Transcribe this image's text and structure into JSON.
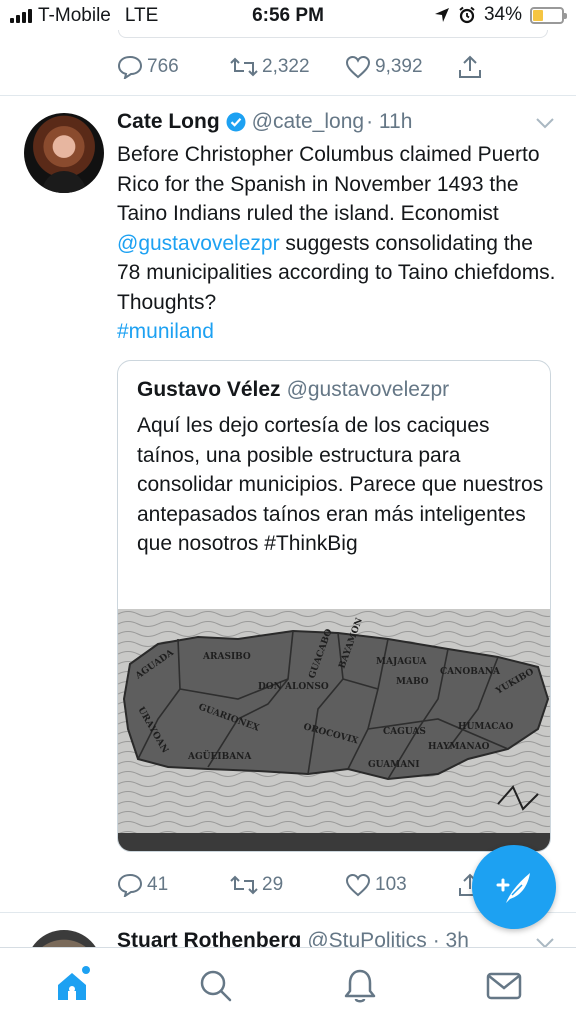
{
  "status_bar": {
    "carrier": "T-Mobile",
    "network": "LTE",
    "time": "6:56 PM",
    "battery": "34%",
    "battery_level": 0.34,
    "icons": [
      "signal-icon",
      "location-arrow-icon",
      "alarm-clock-icon",
      "battery-icon"
    ]
  },
  "previous_tweet": {
    "replies": "766",
    "retweets": "2,322",
    "likes": "9,392"
  },
  "tweet": {
    "name": "Cate Long",
    "handle": "@cate_long",
    "time": "· 11h",
    "text_before_mention": "Before Christopher Columbus claimed Puerto Rico for the Spanish in November 1493 the Taino Indians ruled the island. Economist ",
    "mention": "@gustavovelezpr",
    "text_after_mention": " suggests consolidating the 78 municipalities according to Taino chiefdoms. Thoughts?",
    "hashtag": "#muniland",
    "replies": "41",
    "retweets": "29",
    "likes": "103",
    "quote": {
      "name": "Gustavo Vélez",
      "handle": "@gustavovelezpr",
      "text": "Aquí les dejo cortesía de los caciques taínos, una posible estructura para consolidar municipios. Parece que nuestros antepasados taínos eran más inteligentes que nosotros #ThinkBig",
      "map_labels": [
        "ARASIBO",
        "BAYAMON",
        "MAJAGUA",
        "MABO",
        "CANOBANA",
        "YUKIBO",
        "AGUADA",
        "GUACABO",
        "HAYMANAO",
        "DON ALONSO",
        "GUARIONEX",
        "OROCOVIX",
        "CAGUAS",
        "HUMACAO",
        "AGÜEIBANA",
        "GUAMANI",
        "URAYOAN"
      ]
    }
  },
  "next_tweet": {
    "name": "Stuart Rothenberg",
    "handle": "@StuPolitics",
    "time": "· 3h"
  },
  "tab_bar": {
    "tabs": [
      "home-icon",
      "search-icon",
      "notifications-bell-icon",
      "messages-envelope-icon"
    ],
    "active": "home-icon"
  },
  "colors": {
    "accent": "#1da1f2",
    "text": "#14171a",
    "secondary_text": "#657786",
    "divider": "#e1e8ed"
  }
}
